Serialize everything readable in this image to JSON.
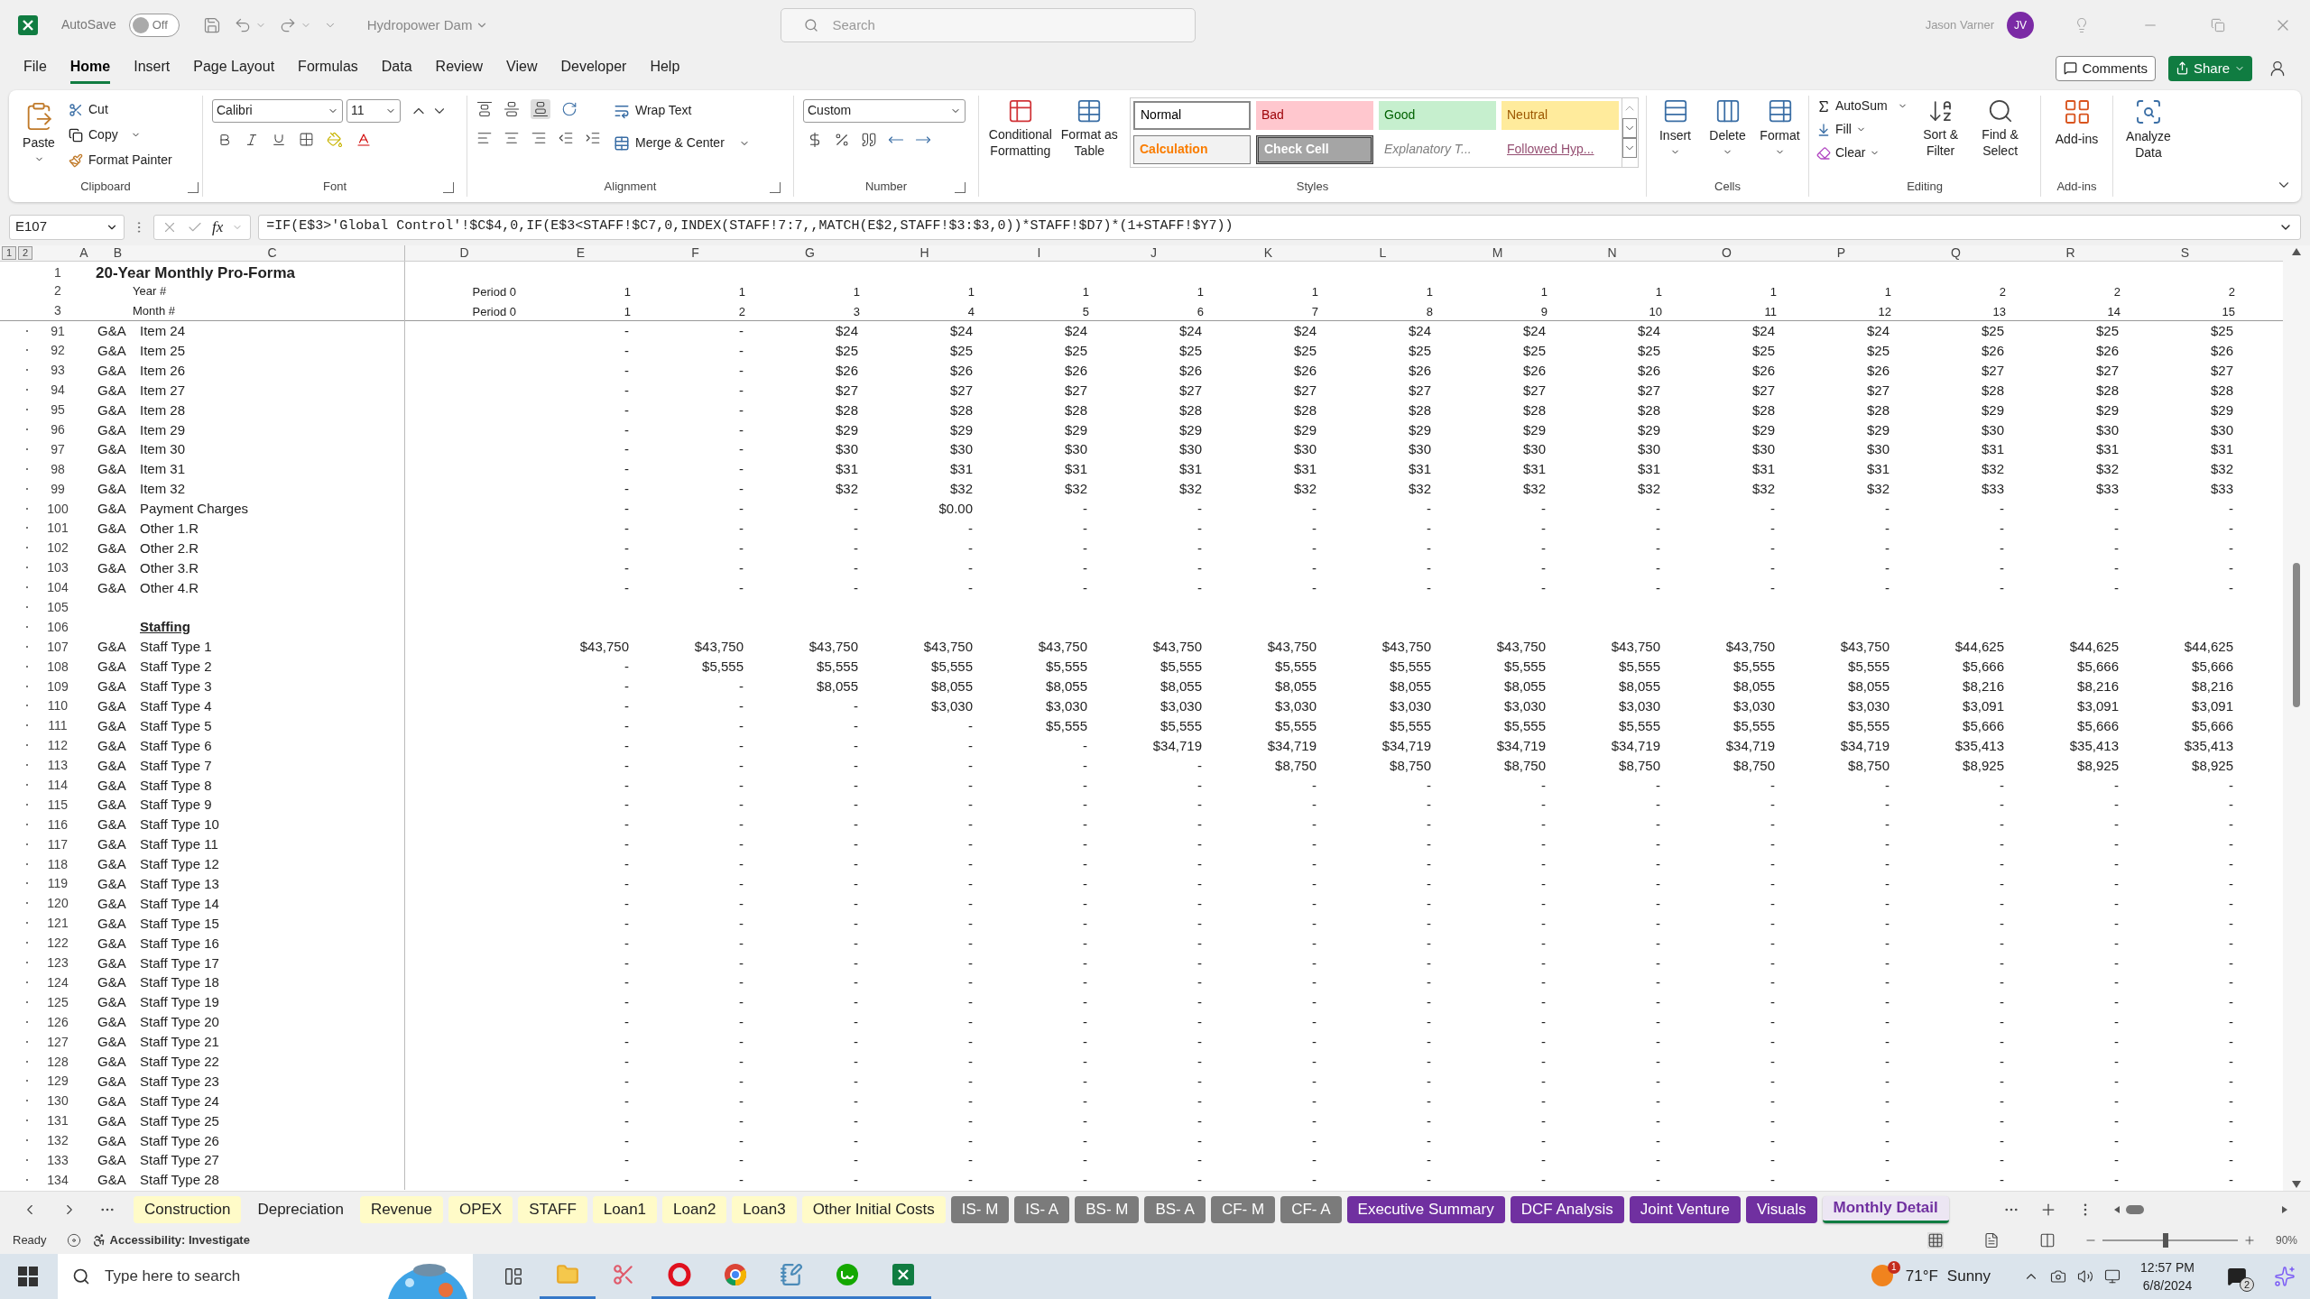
{
  "title_bar": {
    "autosave": {
      "label": "AutoSave",
      "state": "Off",
      "on": false
    },
    "file_name": "Hydropower Dam",
    "search_placeholder": "Search",
    "user_name": "Jason Varner",
    "user_initials": "JV"
  },
  "menu_tabs": [
    {
      "label": "File",
      "selected": false
    },
    {
      "label": "Home",
      "selected": true
    },
    {
      "label": "Insert",
      "selected": false
    },
    {
      "label": "Page Layout",
      "selected": false
    },
    {
      "label": "Formulas",
      "selected": false
    },
    {
      "label": "Data",
      "selected": false
    },
    {
      "label": "Review",
      "selected": false
    },
    {
      "label": "View",
      "selected": false
    },
    {
      "label": "Developer",
      "selected": false
    },
    {
      "label": "Help",
      "selected": false
    }
  ],
  "comments_button": "Comments",
  "share_button": "Share",
  "ribbon": {
    "clipboard": {
      "label": "Clipboard",
      "paste": "Paste",
      "cut": "Cut",
      "copy": "Copy",
      "format_painter": "Format Painter"
    },
    "font": {
      "label": "Font",
      "font_name": "Calibri",
      "font_size": "11"
    },
    "alignment": {
      "label": "Alignment",
      "wrap_text": "Wrap Text",
      "merge_center": "Merge & Center"
    },
    "number": {
      "label": "Number",
      "format": "Custom"
    },
    "styles": {
      "label": "Styles",
      "conditional_formatting": "Conditional Formatting",
      "format_as_table": "Format as Table",
      "cell_styles": [
        {
          "label": "Normal",
          "kind": "normal"
        },
        {
          "label": "Bad",
          "kind": "bad"
        },
        {
          "label": "Good",
          "kind": "good"
        },
        {
          "label": "Neutral",
          "kind": "neutral"
        },
        {
          "label": "Calculation",
          "kind": "calculation"
        },
        {
          "label": "Check Cell",
          "kind": "check"
        },
        {
          "label": "Explanatory T...",
          "kind": "explanatory"
        },
        {
          "label": "Followed Hyp...",
          "kind": "hyperlink"
        }
      ]
    },
    "cells": {
      "label": "Cells",
      "insert": "Insert",
      "delete": "Delete",
      "format": "Format"
    },
    "editing": {
      "label": "Editing",
      "autosum": "AutoSum",
      "fill": "Fill",
      "clear": "Clear",
      "sort_filter": "Sort & Filter",
      "find_select": "Find & Select"
    },
    "addins": {
      "label": "Add-ins",
      "button": "Add-ins"
    },
    "analyze": {
      "button": "Analyze Data"
    }
  },
  "formula_bar": {
    "name_box": "E107",
    "fx": "fx",
    "formula": "=IF(E$3>'Global Control'!$C$4,0,IF(E$3<STAFF!$C7,0,INDEX(STAFF!7:7,,MATCH(E$2,STAFF!$3:$3,0))*STAFF!$D7)*(1+STAFF!$Y7))"
  },
  "outline_levels": [
    "1",
    "2"
  ],
  "columns": [
    "A",
    "B",
    "C",
    "D",
    "E",
    "F",
    "G",
    "H",
    "I",
    "J",
    "K",
    "L",
    "M",
    "N",
    "O",
    "P",
    "Q",
    "R",
    "S"
  ],
  "frozen_rows": [
    {
      "row": "1",
      "title": "20-Year Monthly Pro-Forma"
    },
    {
      "row": "2",
      "label": "Year #",
      "period": "Period 0",
      "values": [
        "1",
        "1",
        "1",
        "1",
        "1",
        "1",
        "1",
        "1",
        "1",
        "1",
        "1",
        "1",
        "2",
        "2",
        "2"
      ]
    },
    {
      "row": "3",
      "label": "Month #",
      "period": "Period 0",
      "values": [
        "1",
        "2",
        "3",
        "4",
        "5",
        "6",
        "7",
        "8",
        "9",
        "10",
        "11",
        "12",
        "13",
        "14",
        "15"
      ]
    }
  ],
  "rows": [
    {
      "row": "91",
      "kind": "data",
      "category": "G&A",
      "item": "Item 24",
      "values": [
        "-",
        "-",
        "$24",
        "$24",
        "$24",
        "$24",
        "$24",
        "$24",
        "$24",
        "$24",
        "$24",
        "$24",
        "$25",
        "$25",
        "$25"
      ]
    },
    {
      "row": "92",
      "kind": "data",
      "category": "G&A",
      "item": "Item 25",
      "values": [
        "-",
        "-",
        "$25",
        "$25",
        "$25",
        "$25",
        "$25",
        "$25",
        "$25",
        "$25",
        "$25",
        "$25",
        "$26",
        "$26",
        "$26"
      ]
    },
    {
      "row": "93",
      "kind": "data",
      "category": "G&A",
      "item": "Item 26",
      "values": [
        "-",
        "-",
        "$26",
        "$26",
        "$26",
        "$26",
        "$26",
        "$26",
        "$26",
        "$26",
        "$26",
        "$26",
        "$27",
        "$27",
        "$27"
      ]
    },
    {
      "row": "94",
      "kind": "data",
      "category": "G&A",
      "item": "Item 27",
      "values": [
        "-",
        "-",
        "$27",
        "$27",
        "$27",
        "$27",
        "$27",
        "$27",
        "$27",
        "$27",
        "$27",
        "$27",
        "$28",
        "$28",
        "$28"
      ]
    },
    {
      "row": "95",
      "kind": "data",
      "category": "G&A",
      "item": "Item 28",
      "values": [
        "-",
        "-",
        "$28",
        "$28",
        "$28",
        "$28",
        "$28",
        "$28",
        "$28",
        "$28",
        "$28",
        "$28",
        "$29",
        "$29",
        "$29"
      ]
    },
    {
      "row": "96",
      "kind": "data",
      "category": "G&A",
      "item": "Item 29",
      "values": [
        "-",
        "-",
        "$29",
        "$29",
        "$29",
        "$29",
        "$29",
        "$29",
        "$29",
        "$29",
        "$29",
        "$29",
        "$30",
        "$30",
        "$30"
      ]
    },
    {
      "row": "97",
      "kind": "data",
      "category": "G&A",
      "item": "Item 30",
      "values": [
        "-",
        "-",
        "$30",
        "$30",
        "$30",
        "$30",
        "$30",
        "$30",
        "$30",
        "$30",
        "$30",
        "$30",
        "$31",
        "$31",
        "$31"
      ]
    },
    {
      "row": "98",
      "kind": "data",
      "category": "G&A",
      "item": "Item 31",
      "values": [
        "-",
        "-",
        "$31",
        "$31",
        "$31",
        "$31",
        "$31",
        "$31",
        "$31",
        "$31",
        "$31",
        "$31",
        "$32",
        "$32",
        "$32"
      ]
    },
    {
      "row": "99",
      "kind": "data",
      "category": "G&A",
      "item": "Item 32",
      "values": [
        "-",
        "-",
        "$32",
        "$32",
        "$32",
        "$32",
        "$32",
        "$32",
        "$32",
        "$32",
        "$32",
        "$32",
        "$33",
        "$33",
        "$33"
      ]
    },
    {
      "row": "100",
      "kind": "data",
      "category": "G&A",
      "item": "Payment Charges",
      "values": [
        "-",
        "-",
        "-",
        "$0.00",
        "-",
        "-",
        "-",
        "-",
        "-",
        "-",
        "-",
        "-",
        "-",
        "-",
        "-"
      ]
    },
    {
      "row": "101",
      "kind": "data",
      "category": "G&A",
      "item": "Other 1.R",
      "values": [
        "-",
        "-",
        "-",
        "-",
        "-",
        "-",
        "-",
        "-",
        "-",
        "-",
        "-",
        "-",
        "-",
        "-",
        "-"
      ]
    },
    {
      "row": "102",
      "kind": "data",
      "category": "G&A",
      "item": "Other 2.R",
      "values": [
        "-",
        "-",
        "-",
        "-",
        "-",
        "-",
        "-",
        "-",
        "-",
        "-",
        "-",
        "-",
        "-",
        "-",
        "-"
      ]
    },
    {
      "row": "103",
      "kind": "data",
      "category": "G&A",
      "item": "Other 3.R",
      "values": [
        "-",
        "-",
        "-",
        "-",
        "-",
        "-",
        "-",
        "-",
        "-",
        "-",
        "-",
        "-",
        "-",
        "-",
        "-"
      ]
    },
    {
      "row": "104",
      "kind": "data",
      "category": "G&A",
      "item": "Other 4.R",
      "values": [
        "-",
        "-",
        "-",
        "-",
        "-",
        "-",
        "-",
        "-",
        "-",
        "-",
        "-",
        "-",
        "-",
        "-",
        "-"
      ]
    },
    {
      "row": "105",
      "kind": "blank"
    },
    {
      "row": "106",
      "kind": "section",
      "item": "Staffing"
    },
    {
      "row": "107",
      "kind": "data",
      "category": "G&A",
      "item": "Staff Type 1",
      "values": [
        "$43,750",
        "$43,750",
        "$43,750",
        "$43,750",
        "$43,750",
        "$43,750",
        "$43,750",
        "$43,750",
        "$43,750",
        "$43,750",
        "$43,750",
        "$43,750",
        "$44,625",
        "$44,625",
        "$44,625"
      ]
    },
    {
      "row": "108",
      "kind": "data",
      "category": "G&A",
      "item": "Staff Type 2",
      "values": [
        "-",
        "$5,555",
        "$5,555",
        "$5,555",
        "$5,555",
        "$5,555",
        "$5,555",
        "$5,555",
        "$5,555",
        "$5,555",
        "$5,555",
        "$5,555",
        "$5,666",
        "$5,666",
        "$5,666"
      ]
    },
    {
      "row": "109",
      "kind": "data",
      "category": "G&A",
      "item": "Staff Type 3",
      "values": [
        "-",
        "-",
        "$8,055",
        "$8,055",
        "$8,055",
        "$8,055",
        "$8,055",
        "$8,055",
        "$8,055",
        "$8,055",
        "$8,055",
        "$8,055",
        "$8,216",
        "$8,216",
        "$8,216"
      ]
    },
    {
      "row": "110",
      "kind": "data",
      "category": "G&A",
      "item": "Staff Type 4",
      "values": [
        "-",
        "-",
        "-",
        "$3,030",
        "$3,030",
        "$3,030",
        "$3,030",
        "$3,030",
        "$3,030",
        "$3,030",
        "$3,030",
        "$3,030",
        "$3,091",
        "$3,091",
        "$3,091"
      ]
    },
    {
      "row": "111",
      "kind": "data",
      "category": "G&A",
      "item": "Staff Type 5",
      "values": [
        "-",
        "-",
        "-",
        "-",
        "$5,555",
        "$5,555",
        "$5,555",
        "$5,555",
        "$5,555",
        "$5,555",
        "$5,555",
        "$5,555",
        "$5,666",
        "$5,666",
        "$5,666"
      ]
    },
    {
      "row": "112",
      "kind": "data",
      "category": "G&A",
      "item": "Staff Type 6",
      "values": [
        "-",
        "-",
        "-",
        "-",
        "-",
        "$34,719",
        "$34,719",
        "$34,719",
        "$34,719",
        "$34,719",
        "$34,719",
        "$34,719",
        "$35,413",
        "$35,413",
        "$35,413"
      ]
    },
    {
      "row": "113",
      "kind": "data",
      "category": "G&A",
      "item": "Staff Type 7",
      "values": [
        "-",
        "-",
        "-",
        "-",
        "-",
        "-",
        "$8,750",
        "$8,750",
        "$8,750",
        "$8,750",
        "$8,750",
        "$8,750",
        "$8,925",
        "$8,925",
        "$8,925"
      ]
    },
    {
      "row": "114",
      "kind": "data",
      "category": "G&A",
      "item": "Staff Type 8",
      "values": [
        "-",
        "-",
        "-",
        "-",
        "-",
        "-",
        "-",
        "-",
        "-",
        "-",
        "-",
        "-",
        "-",
        "-",
        "-"
      ]
    },
    {
      "row": "115",
      "kind": "data",
      "category": "G&A",
      "item": "Staff Type 9",
      "values": [
        "-",
        "-",
        "-",
        "-",
        "-",
        "-",
        "-",
        "-",
        "-",
        "-",
        "-",
        "-",
        "-",
        "-",
        "-"
      ]
    },
    {
      "row": "116",
      "kind": "data",
      "category": "G&A",
      "item": "Staff Type 10",
      "values": [
        "-",
        "-",
        "-",
        "-",
        "-",
        "-",
        "-",
        "-",
        "-",
        "-",
        "-",
        "-",
        "-",
        "-",
        "-"
      ]
    },
    {
      "row": "117",
      "kind": "data",
      "category": "G&A",
      "item": "Staff Type 11",
      "values": [
        "-",
        "-",
        "-",
        "-",
        "-",
        "-",
        "-",
        "-",
        "-",
        "-",
        "-",
        "-",
        "-",
        "-",
        "-"
      ]
    },
    {
      "row": "118",
      "kind": "data",
      "category": "G&A",
      "item": "Staff Type 12",
      "values": [
        "-",
        "-",
        "-",
        "-",
        "-",
        "-",
        "-",
        "-",
        "-",
        "-",
        "-",
        "-",
        "-",
        "-",
        "-"
      ]
    },
    {
      "row": "119",
      "kind": "data",
      "category": "G&A",
      "item": "Staff Type 13",
      "values": [
        "-",
        "-",
        "-",
        "-",
        "-",
        "-",
        "-",
        "-",
        "-",
        "-",
        "-",
        "-",
        "-",
        "-",
        "-"
      ]
    },
    {
      "row": "120",
      "kind": "data",
      "category": "G&A",
      "item": "Staff Type 14",
      "values": [
        "-",
        "-",
        "-",
        "-",
        "-",
        "-",
        "-",
        "-",
        "-",
        "-",
        "-",
        "-",
        "-",
        "-",
        "-"
      ]
    },
    {
      "row": "121",
      "kind": "data",
      "category": "G&A",
      "item": "Staff Type 15",
      "values": [
        "-",
        "-",
        "-",
        "-",
        "-",
        "-",
        "-",
        "-",
        "-",
        "-",
        "-",
        "-",
        "-",
        "-",
        "-"
      ]
    },
    {
      "row": "122",
      "kind": "data",
      "category": "G&A",
      "item": "Staff Type 16",
      "values": [
        "-",
        "-",
        "-",
        "-",
        "-",
        "-",
        "-",
        "-",
        "-",
        "-",
        "-",
        "-",
        "-",
        "-",
        "-"
      ]
    },
    {
      "row": "123",
      "kind": "data",
      "category": "G&A",
      "item": "Staff Type 17",
      "values": [
        "-",
        "-",
        "-",
        "-",
        "-",
        "-",
        "-",
        "-",
        "-",
        "-",
        "-",
        "-",
        "-",
        "-",
        "-"
      ]
    },
    {
      "row": "124",
      "kind": "data",
      "category": "G&A",
      "item": "Staff Type 18",
      "values": [
        "-",
        "-",
        "-",
        "-",
        "-",
        "-",
        "-",
        "-",
        "-",
        "-",
        "-",
        "-",
        "-",
        "-",
        "-"
      ]
    },
    {
      "row": "125",
      "kind": "data",
      "category": "G&A",
      "item": "Staff Type 19",
      "values": [
        "-",
        "-",
        "-",
        "-",
        "-",
        "-",
        "-",
        "-",
        "-",
        "-",
        "-",
        "-",
        "-",
        "-",
        "-"
      ]
    },
    {
      "row": "126",
      "kind": "data",
      "category": "G&A",
      "item": "Staff Type 20",
      "values": [
        "-",
        "-",
        "-",
        "-",
        "-",
        "-",
        "-",
        "-",
        "-",
        "-",
        "-",
        "-",
        "-",
        "-",
        "-"
      ]
    },
    {
      "row": "127",
      "kind": "data",
      "category": "G&A",
      "item": "Staff Type 21",
      "values": [
        "-",
        "-",
        "-",
        "-",
        "-",
        "-",
        "-",
        "-",
        "-",
        "-",
        "-",
        "-",
        "-",
        "-",
        "-"
      ]
    },
    {
      "row": "128",
      "kind": "data",
      "category": "G&A",
      "item": "Staff Type 22",
      "values": [
        "-",
        "-",
        "-",
        "-",
        "-",
        "-",
        "-",
        "-",
        "-",
        "-",
        "-",
        "-",
        "-",
        "-",
        "-"
      ]
    },
    {
      "row": "129",
      "kind": "data",
      "category": "G&A",
      "item": "Staff Type 23",
      "values": [
        "-",
        "-",
        "-",
        "-",
        "-",
        "-",
        "-",
        "-",
        "-",
        "-",
        "-",
        "-",
        "-",
        "-",
        "-"
      ]
    },
    {
      "row": "130",
      "kind": "data",
      "category": "G&A",
      "item": "Staff Type 24",
      "values": [
        "-",
        "-",
        "-",
        "-",
        "-",
        "-",
        "-",
        "-",
        "-",
        "-",
        "-",
        "-",
        "-",
        "-",
        "-"
      ]
    },
    {
      "row": "131",
      "kind": "data",
      "category": "G&A",
      "item": "Staff Type 25",
      "values": [
        "-",
        "-",
        "-",
        "-",
        "-",
        "-",
        "-",
        "-",
        "-",
        "-",
        "-",
        "-",
        "-",
        "-",
        "-"
      ]
    },
    {
      "row": "132",
      "kind": "data",
      "category": "G&A",
      "item": "Staff Type 26",
      "values": [
        "-",
        "-",
        "-",
        "-",
        "-",
        "-",
        "-",
        "-",
        "-",
        "-",
        "-",
        "-",
        "-",
        "-",
        "-"
      ]
    },
    {
      "row": "133",
      "kind": "data",
      "category": "G&A",
      "item": "Staff Type 27",
      "values": [
        "-",
        "-",
        "-",
        "-",
        "-",
        "-",
        "-",
        "-",
        "-",
        "-",
        "-",
        "-",
        "-",
        "-",
        "-"
      ]
    },
    {
      "row": "134",
      "kind": "data",
      "category": "G&A",
      "item": "Staff Type 28",
      "values": [
        "-",
        "-",
        "-",
        "-",
        "-",
        "-",
        "-",
        "-",
        "-",
        "-",
        "-",
        "-",
        "-",
        "-",
        "-"
      ]
    }
  ],
  "sheet_tabs": [
    {
      "label": "Construction",
      "color": "#fffbc8",
      "selected": false
    },
    {
      "label": "Depreciation",
      "color": "#f0f0f0",
      "selected": false
    },
    {
      "label": "Revenue",
      "color": "#fffbc8",
      "selected": false
    },
    {
      "label": "OPEX",
      "color": "#fffbc8",
      "selected": false
    },
    {
      "label": "STAFF",
      "color": "#fffbc8",
      "selected": false
    },
    {
      "label": "Loan1",
      "color": "#fffbc8",
      "selected": false
    },
    {
      "label": "Loan2",
      "color": "#fffbc8",
      "selected": false
    },
    {
      "label": "Loan3",
      "color": "#fffbc8",
      "selected": false
    },
    {
      "label": "Other Initial Costs",
      "color": "#fffbc8",
      "selected": false
    },
    {
      "label": "IS- M",
      "color": "#7b7b7b",
      "selected": false
    },
    {
      "label": "IS- A",
      "color": "#7b7b7b",
      "selected": false
    },
    {
      "label": "BS- M",
      "color": "#7b7b7b",
      "selected": false
    },
    {
      "label": "BS- A",
      "color": "#7b7b7b",
      "selected": false
    },
    {
      "label": "CF- M",
      "color": "#7b7b7b",
      "selected": false
    },
    {
      "label": "CF- A",
      "color": "#7b7b7b",
      "selected": false
    },
    {
      "label": "Executive Summary",
      "color": "#7030a0",
      "selected": false
    },
    {
      "label": "DCF Analysis",
      "color": "#7030a0",
      "selected": false
    },
    {
      "label": "Joint Venture",
      "color": "#7030a0",
      "selected": false
    },
    {
      "label": "Visuals",
      "color": "#7030a0",
      "selected": false
    },
    {
      "label": "Monthly Detail",
      "color": "#7030a0",
      "selected": true
    }
  ],
  "status_bar": {
    "ready": "Ready",
    "accessibility": "Accessibility: Investigate",
    "zoom_slider": {
      "level": 0.47
    },
    "zoom": "90%"
  },
  "taskbar": {
    "search_placeholder": "Type here to search",
    "apps": [
      {
        "kind": "explorer",
        "running": true
      },
      {
        "kind": "snipping",
        "running": false
      },
      {
        "kind": "opera",
        "running": true
      },
      {
        "kind": "chrome",
        "running": true
      },
      {
        "kind": "notepad",
        "running": true
      },
      {
        "kind": "upwork",
        "running": true
      },
      {
        "kind": "excel",
        "running": true
      }
    ],
    "weather_badge": "1",
    "temperature": "71°F",
    "weather": "Sunny",
    "time": "12:57 PM",
    "date": "6/8/2024",
    "notifications": "2"
  }
}
